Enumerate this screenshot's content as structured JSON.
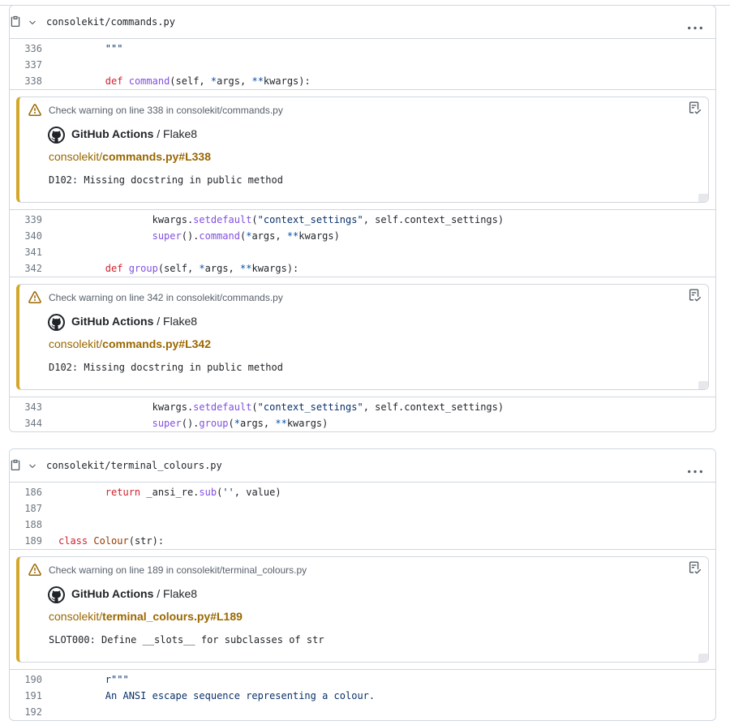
{
  "files": [
    {
      "name": "consolekit/commands.py",
      "sections": [
        {
          "kind": "code",
          "lines": [
            {
              "n": "336",
              "segs": [
                {
                  "t": "        "
                },
                {
                  "t": "\"\"\"",
                  "c": "str"
                }
              ]
            },
            {
              "n": "337",
              "segs": []
            },
            {
              "n": "338",
              "segs": [
                {
                  "t": "        "
                },
                {
                  "t": "def",
                  "c": "kw"
                },
                {
                  "t": " "
                },
                {
                  "t": "command",
                  "c": "fn"
                },
                {
                  "t": "(self, "
                },
                {
                  "t": "*",
                  "c": "op"
                },
                {
                  "t": "args, "
                },
                {
                  "t": "**",
                  "c": "op"
                },
                {
                  "t": "kwargs):"
                }
              ]
            }
          ]
        },
        {
          "kind": "annotation",
          "title": "Check warning on line 338 in consolekit/commands.py",
          "app": "GitHub Actions",
          "check": "Flake8",
          "link_dir": "consolekit/",
          "link_file": "commands.py#L338",
          "message": "D102: Missing docstring in public method"
        },
        {
          "kind": "code",
          "lines": [
            {
              "n": "339",
              "segs": [
                {
                  "t": "                kwargs."
                },
                {
                  "t": "setdefault",
                  "c": "fn"
                },
                {
                  "t": "("
                },
                {
                  "t": "\"context_settings\"",
                  "c": "str"
                },
                {
                  "t": ", self.context_settings)"
                }
              ]
            },
            {
              "n": "340",
              "segs": [
                {
                  "t": "                "
                },
                {
                  "t": "super",
                  "c": "fn"
                },
                {
                  "t": "()."
                },
                {
                  "t": "command",
                  "c": "fn"
                },
                {
                  "t": "("
                },
                {
                  "t": "*",
                  "c": "op"
                },
                {
                  "t": "args, "
                },
                {
                  "t": "**",
                  "c": "op"
                },
                {
                  "t": "kwargs)"
                }
              ]
            },
            {
              "n": "341",
              "segs": []
            },
            {
              "n": "342",
              "segs": [
                {
                  "t": "        "
                },
                {
                  "t": "def",
                  "c": "kw"
                },
                {
                  "t": " "
                },
                {
                  "t": "group",
                  "c": "fn"
                },
                {
                  "t": "(self, "
                },
                {
                  "t": "*",
                  "c": "op"
                },
                {
                  "t": "args, "
                },
                {
                  "t": "**",
                  "c": "op"
                },
                {
                  "t": "kwargs):"
                }
              ]
            }
          ]
        },
        {
          "kind": "annotation",
          "title": "Check warning on line 342 in consolekit/commands.py",
          "app": "GitHub Actions",
          "check": "Flake8",
          "link_dir": "consolekit/",
          "link_file": "commands.py#L342",
          "message": "D102: Missing docstring in public method"
        },
        {
          "kind": "code",
          "lines": [
            {
              "n": "343",
              "segs": [
                {
                  "t": "                kwargs."
                },
                {
                  "t": "setdefault",
                  "c": "fn"
                },
                {
                  "t": "("
                },
                {
                  "t": "\"context_settings\"",
                  "c": "str"
                },
                {
                  "t": ", self.context_settings)"
                }
              ]
            },
            {
              "n": "344",
              "segs": [
                {
                  "t": "                "
                },
                {
                  "t": "super",
                  "c": "fn"
                },
                {
                  "t": "()."
                },
                {
                  "t": "group",
                  "c": "fn"
                },
                {
                  "t": "("
                },
                {
                  "t": "*",
                  "c": "op"
                },
                {
                  "t": "args, "
                },
                {
                  "t": "**",
                  "c": "op"
                },
                {
                  "t": "kwargs)"
                }
              ]
            }
          ]
        }
      ]
    },
    {
      "name": "consolekit/terminal_colours.py",
      "sections": [
        {
          "kind": "code",
          "lines": [
            {
              "n": "186",
              "segs": [
                {
                  "t": "        "
                },
                {
                  "t": "return",
                  "c": "kw"
                },
                {
                  "t": " _ansi_re."
                },
                {
                  "t": "sub",
                  "c": "fn"
                },
                {
                  "t": "("
                },
                {
                  "t": "''",
                  "c": "str"
                },
                {
                  "t": ", value)"
                }
              ]
            },
            {
              "n": "187",
              "segs": []
            },
            {
              "n": "188",
              "segs": []
            },
            {
              "n": "189",
              "segs": [
                {
                  "t": "class",
                  "c": "kw"
                },
                {
                  "t": " "
                },
                {
                  "t": "Colour",
                  "c": "fn2"
                },
                {
                  "t": "(str):"
                }
              ]
            }
          ]
        },
        {
          "kind": "annotation",
          "title": "Check warning on line 189 in consolekit/terminal_colours.py",
          "app": "GitHub Actions",
          "check": "Flake8",
          "link_dir": "consolekit/",
          "link_file": "terminal_colours.py#L189",
          "message": "SLOT000: Define __slots__ for subclasses of str"
        },
        {
          "kind": "code",
          "lines": [
            {
              "n": "190",
              "segs": [
                {
                  "t": "        "
                },
                {
                  "t": "r\"\"\"",
                  "c": "str"
                }
              ]
            },
            {
              "n": "191",
              "segs": [
                {
                  "t": "        "
                },
                {
                  "t": "An ANSI escape sequence representing a colour.",
                  "c": "str"
                }
              ]
            },
            {
              "n": "192",
              "segs": []
            }
          ]
        }
      ]
    }
  ],
  "colors": {
    "warning_border": "#d4a72c",
    "link": "#9a6700",
    "keyword": "#cf222e",
    "function": "#8250df",
    "string": "#0a3069"
  },
  "icons": {
    "collapse": "chevron-down-icon",
    "copy": "copy-icon",
    "more": "kebab-horizontal-icon",
    "warning": "alert-icon",
    "github": "mark-github-icon",
    "view": "checklist-icon"
  }
}
